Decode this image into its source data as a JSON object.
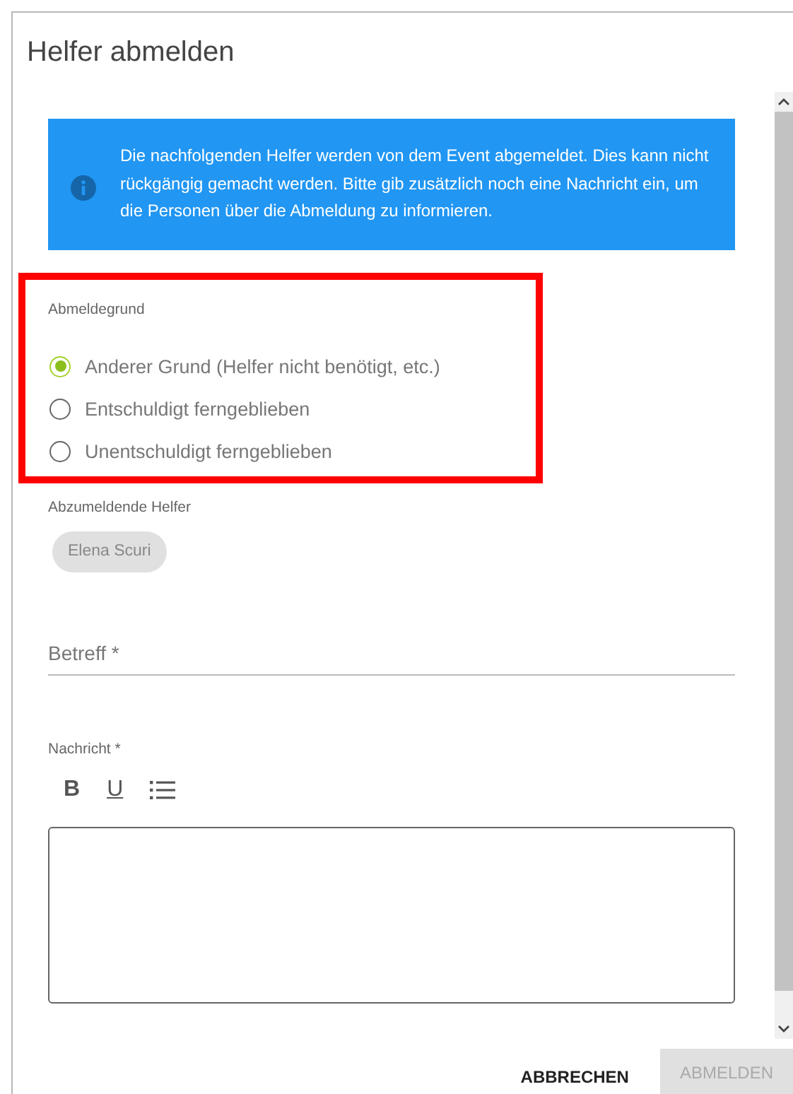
{
  "dialog": {
    "title": "Helfer abmelden"
  },
  "notice": {
    "text": "Die nachfolgenden Helfer werden von dem Event abgemeldet. Dies kann nicht rückgängig gemacht werden. Bitte gib zusätzlich noch eine Nachricht ein, um die Personen über die Abmeldung zu informieren."
  },
  "reason": {
    "label": "Abmeldegrund",
    "options": [
      {
        "label": "Anderer Grund (Helfer nicht benötigt, etc.)",
        "selected": true
      },
      {
        "label": "Entschuldigt ferngeblieben",
        "selected": false
      },
      {
        "label": "Unentschuldigt ferngeblieben",
        "selected": false
      }
    ]
  },
  "helpers": {
    "label": "Abzumeldende Helfer",
    "chips": [
      "Elena Scuri"
    ]
  },
  "subject": {
    "placeholder": "Betreff *"
  },
  "message": {
    "label": "Nachricht *",
    "toolbar": [
      {
        "kind": "bold",
        "text": "B"
      },
      {
        "kind": "underline",
        "text": "U"
      },
      {
        "kind": "list"
      }
    ]
  },
  "buttons": [
    {
      "label": "ABBRECHEN",
      "disabled": false
    },
    {
      "label": "ABMELDEN",
      "disabled": true
    }
  ]
}
